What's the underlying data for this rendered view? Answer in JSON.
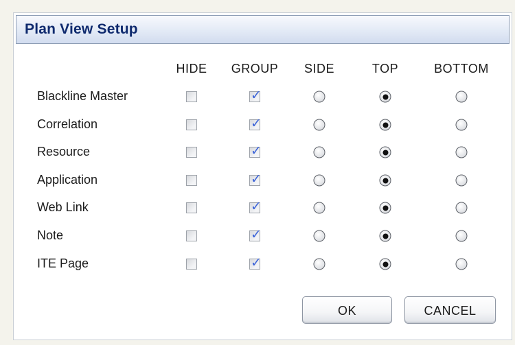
{
  "dialog": {
    "title": "Plan View Setup",
    "columns": [
      "HIDE",
      "GROUP",
      "SIDE",
      "TOP",
      "BOTTOM"
    ],
    "rows": [
      {
        "label": "Blackline Master",
        "hide": false,
        "group": true,
        "position": "TOP"
      },
      {
        "label": "Correlation",
        "hide": false,
        "group": true,
        "position": "TOP"
      },
      {
        "label": "Resource",
        "hide": false,
        "group": true,
        "position": "TOP"
      },
      {
        "label": "Application",
        "hide": false,
        "group": true,
        "position": "TOP"
      },
      {
        "label": "Web Link",
        "hide": false,
        "group": true,
        "position": "TOP"
      },
      {
        "label": "Note",
        "hide": false,
        "group": true,
        "position": "TOP"
      },
      {
        "label": "ITE Page",
        "hide": false,
        "group": true,
        "position": "TOP"
      }
    ],
    "ok_label": "OK",
    "cancel_label": "CANCEL"
  },
  "colors": {
    "title_text": "#0f2a6e",
    "checkmark": "#3b63d8",
    "title_gradient_end": "#d2dcef"
  }
}
